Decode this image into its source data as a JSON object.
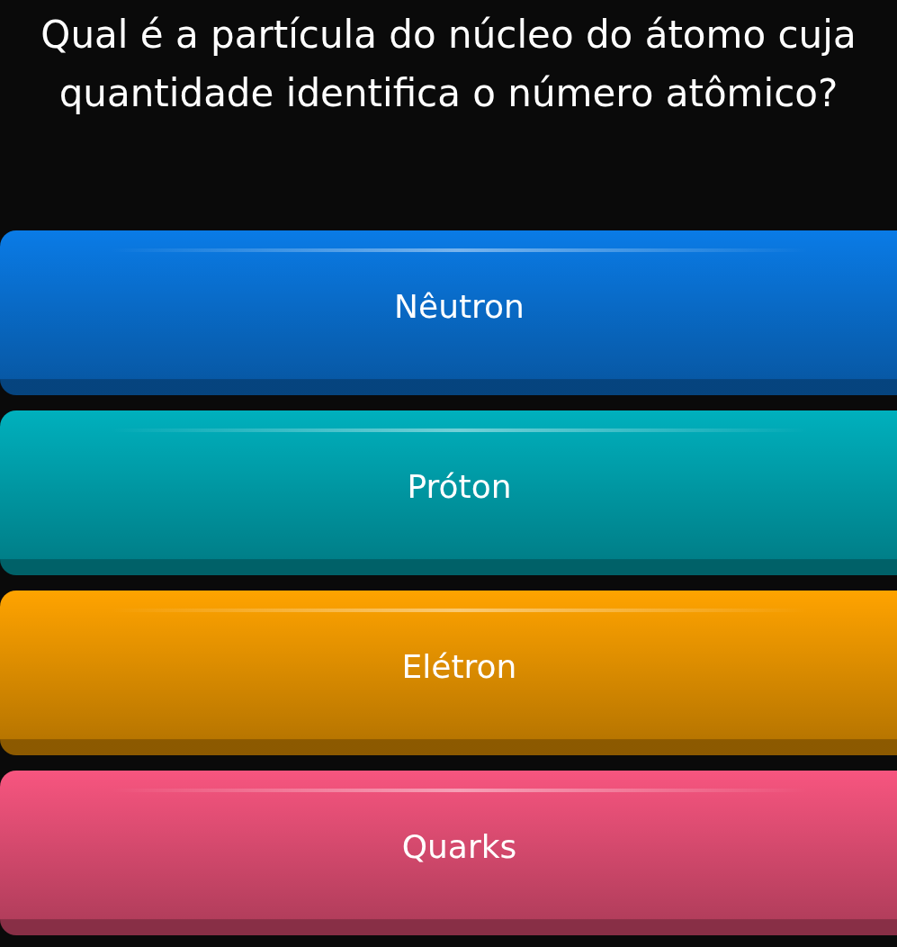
{
  "question": "Qual é a partícula do núcleo do átomo cuja quantidade identifica o número atômico?",
  "answers": [
    {
      "label": "Nêutron",
      "color": "#0a7be6"
    },
    {
      "label": "Próton",
      "color": "#00b0bd"
    },
    {
      "label": "Elétron",
      "color": "#ffa300"
    },
    {
      "label": "Quarks",
      "color": "#f7557f"
    }
  ]
}
